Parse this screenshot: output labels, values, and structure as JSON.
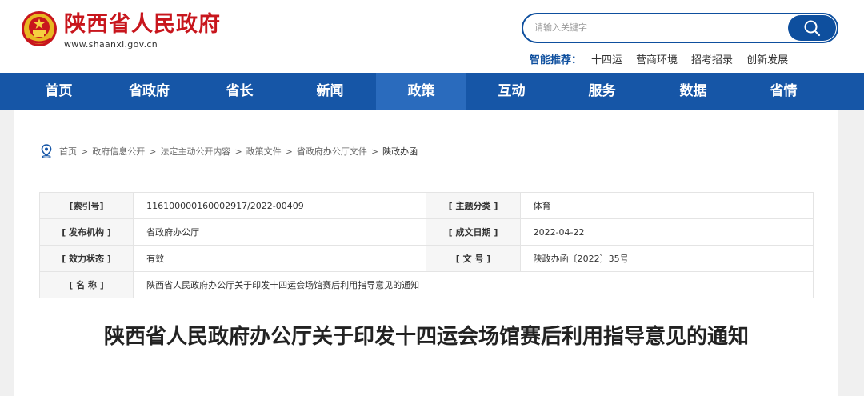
{
  "header": {
    "site_title": "陕西省人民政府",
    "site_url": "www.shaanxi.gov.cn",
    "search": {
      "placeholder": "请输入关键字"
    },
    "hot": {
      "label": "智能推荐：",
      "items": [
        "十四运",
        "营商环境",
        "招考招录",
        "创新发展"
      ]
    }
  },
  "nav": {
    "items": [
      {
        "label": "首页"
      },
      {
        "label": "省政府"
      },
      {
        "label": "省长"
      },
      {
        "label": "新闻"
      },
      {
        "label": "政策"
      },
      {
        "label": "互动"
      },
      {
        "label": "服务"
      },
      {
        "label": "数据"
      },
      {
        "label": "省情"
      }
    ],
    "active_index": 4
  },
  "breadcrumb": [
    "首页",
    "政府信息公开",
    "法定主动公开内容",
    "政策文件",
    "省政府办公厅文件",
    "陕政办函"
  ],
  "breadcrumb_sep": ">",
  "info": {
    "index_label": "[索引号]",
    "index_value": "116100000160002917/2022-00409",
    "topic_label": "[ 主题分类 ]",
    "topic_value": "体育",
    "publisher_label": "[ 发布机构 ]",
    "publisher_value": "省政府办公厅",
    "date_label": "[ 成文日期 ]",
    "date_value": "2022-04-22",
    "status_label": "[ 效力状态 ]",
    "status_value": "有效",
    "docno_label": "[ 文 号 ]",
    "docno_value": "陕政办函〔2022〕35号",
    "name_label": "[ 名 称 ]",
    "name_value": "陕西省人民政府办公厅关于印发十四运会场馆赛后利用指导意见的通知"
  },
  "document": {
    "title": "陕西省人民政府办公厅关于印发十四运会场馆赛后利用指导意见的通知"
  },
  "colors": {
    "brand_red": "#c8161d",
    "nav_blue": "#1656a7",
    "nav_active": "#2a6bbd",
    "search_blue": "#0e4f9e"
  }
}
